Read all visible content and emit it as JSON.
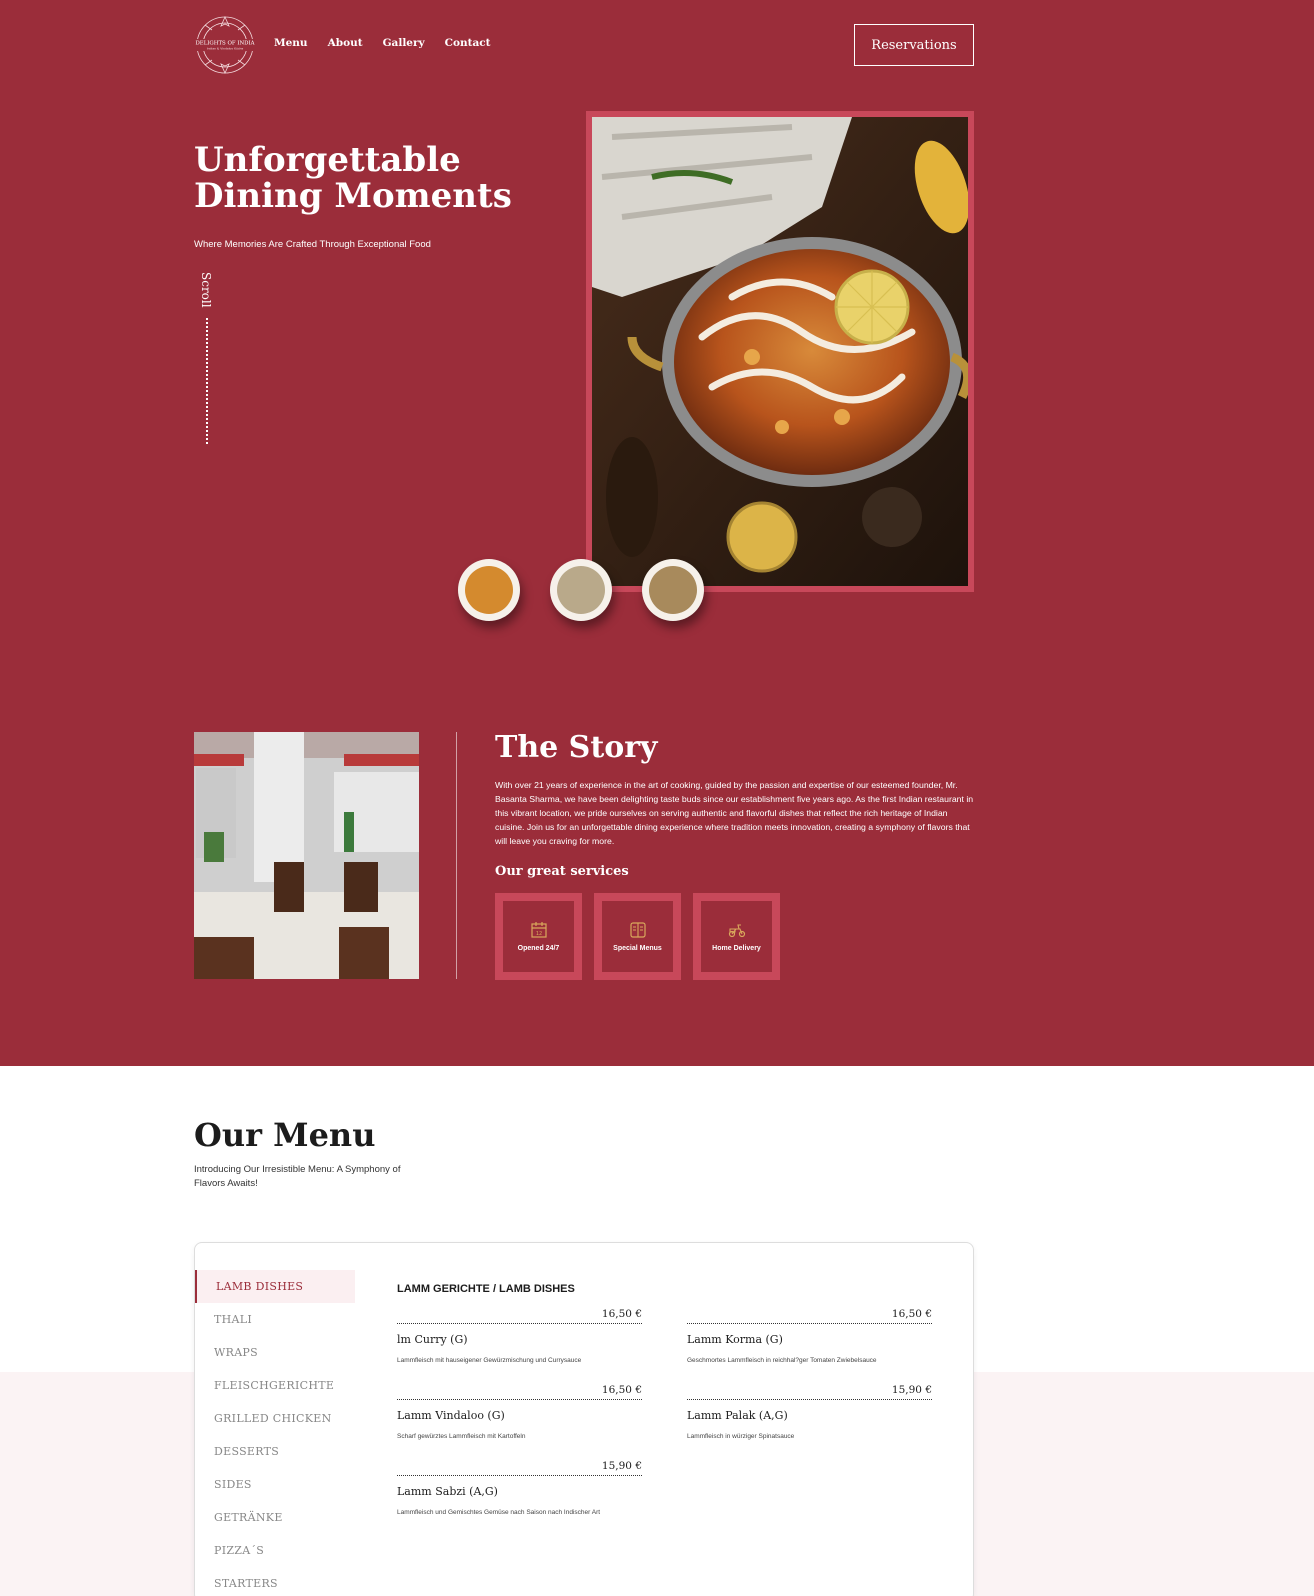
{
  "brand": {
    "logo_text": "DELIGHTS OF INDIA",
    "logo_tagline": "Indian & Vindaloo Küche"
  },
  "nav": {
    "items": [
      "Menu",
      "About",
      "Gallery",
      "Contact"
    ],
    "reservation_label": "Reservations"
  },
  "hero": {
    "title": "Unforgettable Dining Moments",
    "subtitle": "Where Memories Are Crafted Through Exceptional Food",
    "scroll_label": "Scroll"
  },
  "story": {
    "title": "The Story",
    "text": "With over 21 years of experience in the art of cooking, guided by the passion and expertise of our esteemed founder, Mr. Basanta Sharma, we have been delighting taste buds since our establishment five years ago. As the first Indian restaurant in this vibrant location, we pride ourselves on serving authentic and flavorful dishes that reflect the rich heritage of Indian cuisine. Join us for an unforgettable dining experience where tradition meets innovation, creating a symphony of flavors that will leave you craving for more.",
    "services_title": "Our great services",
    "services": [
      {
        "label": "Opened 24/7",
        "icon": "calendar-icon"
      },
      {
        "label": "Special Menus",
        "icon": "menu-book-icon"
      },
      {
        "label": "Home Delivery",
        "icon": "scooter-icon"
      }
    ]
  },
  "menu": {
    "title": "Our Menu",
    "subtitle": "Introducing Our Irresistible Menu: A Symphony of Flavors Awaits!",
    "categories": [
      "LAMB DISHES",
      "THALI",
      "WRAPS",
      "FLEISCHGERICHTE",
      "GRILLED CHICKEN",
      "DESSERTS",
      "SIDES",
      "GETRÄNKE",
      "PIZZA´S",
      "STARTERS"
    ],
    "active_category": "LAMB DISHES",
    "section_title": "LAMM GERICHTE / LAMB DISHES",
    "dishes": [
      {
        "price": "16,50 €",
        "name": "lm Curry (G)",
        "desc": "Lammfleisch mit hauseigener Gewürzmischung und Currysauce"
      },
      {
        "price": "16,50 €",
        "name": "Lamm Korma (G)",
        "desc": "Geschmortes Lammfleisch in reichhal?ger Tomaten Zwiebelsauce"
      },
      {
        "price": "16,50 €",
        "name": "Lamm Vindaloo (G)",
        "desc": "Scharf gewürztes Lammfleisch mit Kartoffeln"
      },
      {
        "price": "15,90 €",
        "name": "Lamm Palak (A,G)",
        "desc": "Lammfleisch in würziger Spinatsauce"
      },
      {
        "price": "15,90 €",
        "name": "Lamm Sabzi (A,G)",
        "desc": "Lammfleisch und Gemischtes Gemüse nach Saison nach Indischer Art"
      }
    ]
  },
  "colors": {
    "brand": "#9b2d3a",
    "accent": "#c8485a",
    "icon_gold": "#d9a85c"
  }
}
